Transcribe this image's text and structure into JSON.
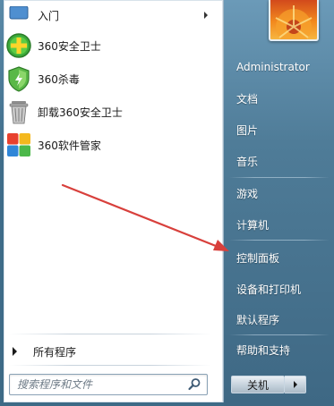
{
  "programs": [
    {
      "label": "入门",
      "icon": "start-icon",
      "has_submenu": true
    },
    {
      "label": "360安全卫士",
      "icon": "360-safe-icon"
    },
    {
      "label": "360杀毒",
      "icon": "360-antivirus-icon"
    },
    {
      "label": "卸载360安全卫士",
      "icon": "uninstall-icon"
    },
    {
      "label": "360软件管家",
      "icon": "360-software-manager-icon"
    }
  ],
  "all_programs_label": "所有程序",
  "search": {
    "placeholder": "搜索程序和文件"
  },
  "right_menu": {
    "user": "Administrator",
    "documents": "文档",
    "pictures": "图片",
    "music": "音乐",
    "games": "游戏",
    "computer": "计算机",
    "control_panel": "控制面板",
    "devices_printers": "设备和打印机",
    "default_programs": "默认程序",
    "help_support": "帮助和支持"
  },
  "shutdown_label": "关机",
  "colors": {
    "annotation_arrow": "#d8403c",
    "right_pane": "#4f7c98"
  }
}
